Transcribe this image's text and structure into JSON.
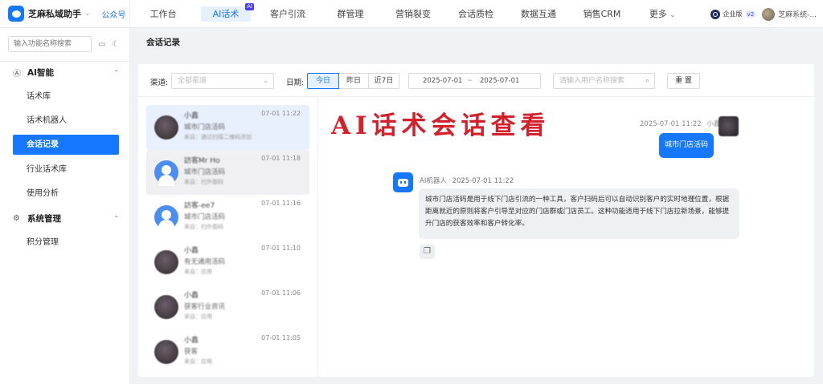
{
  "brand": {
    "name": "芝麻私域助手",
    "channel": "公众号"
  },
  "nav": {
    "items": [
      {
        "label": "工作台"
      },
      {
        "label": "AI话术",
        "badge": "AI"
      },
      {
        "label": "客户引流"
      },
      {
        "label": "群管理"
      },
      {
        "label": "营销裂变"
      },
      {
        "label": "会话质检"
      },
      {
        "label": "数据互通"
      },
      {
        "label": "销售CRM"
      },
      {
        "label": "更多"
      }
    ],
    "active_index": 1
  },
  "account": {
    "edition": "企业版",
    "version": "v2",
    "user": "芝麻系统-..."
  },
  "sidebar": {
    "search_placeholder": "输入功能名称搜索",
    "groups": [
      {
        "label": "AI智能",
        "icon": "ai-icon",
        "items": [
          {
            "label": "话术库"
          },
          {
            "label": "话术机器人"
          },
          {
            "label": "会话记录"
          },
          {
            "label": "行业话术库"
          },
          {
            "label": "使用分析"
          }
        ]
      },
      {
        "label": "系统管理",
        "icon": "gear-icon",
        "items": [
          {
            "label": "积分管理"
          }
        ]
      }
    ],
    "active_item": "会话记录"
  },
  "page": {
    "title": "会话记录"
  },
  "filters": {
    "channel_label": "渠道:",
    "channel_placeholder": "全部渠道",
    "date_label": "日期:",
    "date_options": [
      "今日",
      "昨日",
      "近7日"
    ],
    "date_active": "今日",
    "range_start": "2025-07-01",
    "range_sep": "~",
    "range_end": "2025-07-01",
    "user_search_placeholder": "请输入用户名称搜索",
    "reset_label": "重 置"
  },
  "conversations": [
    {
      "name": "小鑫",
      "message": "城市门店活码",
      "source": "来自：通过扫描二维码添加",
      "time": "07-01 11:22",
      "avatar": "photo",
      "state": "selected"
    },
    {
      "name": "訪客Mr Ho",
      "message": "城市门店活码",
      "source": "来自：扫外面码",
      "time": "07-01 11:18",
      "avatar": "default",
      "state": "hover"
    },
    {
      "name": "訪客-ee7",
      "message": "城市门店活码",
      "source": "来自：扫外面码",
      "time": "07-01 11:16",
      "avatar": "default",
      "state": ""
    },
    {
      "name": "小鑫",
      "message": "有无通用活码",
      "source": "来自：应用",
      "time": "07-01 11:10",
      "avatar": "photo",
      "state": ""
    },
    {
      "name": "小鑫",
      "message": "获客行业资讯",
      "source": "来自：应用",
      "time": "07-01 11:06",
      "avatar": "photo",
      "state": ""
    },
    {
      "name": "小鑫",
      "message": "获客",
      "source": "来自：应用",
      "time": "07-01 11:05",
      "avatar": "photo",
      "state": ""
    }
  ],
  "chat": {
    "overlay_title": "AI话术会话查看",
    "user_time": "2025-07-01 11:22",
    "user_name": "小鑫",
    "user_message": "城市门店活码",
    "bot_name": "AI机器人",
    "bot_time": "2025-07-01 11:22",
    "bot_message": "城市门店活码是用于线下门店引流的一种工具，客户扫码后可以自动识别客户的实时地理位置，根据距离就近的原则将客户引导至对应的门店群或门店员工。这种功能适用于线下门店拉新场景，能够提升门店的获客效率和客户转化率。"
  },
  "colors": {
    "accent": "#1677ff",
    "overlay_red": "#d4202b"
  }
}
